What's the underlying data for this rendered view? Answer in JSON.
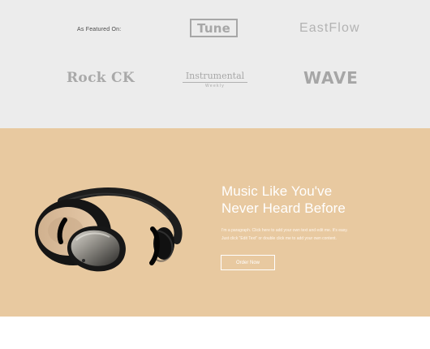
{
  "featured": {
    "label": "As Featured On:",
    "logos": {
      "tune": "Tune",
      "eastflow": "EastFlow",
      "rockck": "Rock CK",
      "instrumental": "Instrumental",
      "instrumental_sub": "Weekly",
      "wave": "WAVE"
    }
  },
  "promo": {
    "title_line1": "Music Like You've",
    "title_line2": "Never Heard Before",
    "paragraph_line1": "I'm a paragraph. Click here to add your own text and edit me. It's easy.",
    "paragraph_line2": "Just click “Edit Text” or double click me to add your own content.",
    "button_label": "Order Now",
    "image_icon": "headphones-image"
  },
  "colors": {
    "featured_background": "#ececec",
    "promo_background": "#e8c9a0",
    "logo_gray": "#a8a8a8",
    "promo_text": "#ffffff"
  }
}
